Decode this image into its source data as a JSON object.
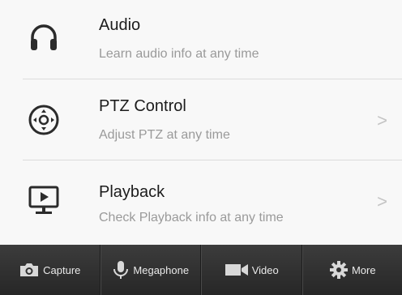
{
  "list": {
    "items": [
      {
        "icon": "headphones-icon",
        "title": "Audio",
        "subtitle": "Learn audio info at any time",
        "chevron": false
      },
      {
        "icon": "ptz-joystick-icon",
        "title": "PTZ Control",
        "subtitle": "Adjust PTZ at any time",
        "chevron": true
      },
      {
        "icon": "playback-monitor-icon",
        "title": "Playback",
        "subtitle": "Check Playback info at any time",
        "chevron": true
      }
    ],
    "chevron_glyph": ">"
  },
  "tabbar": {
    "tabs": [
      {
        "icon": "camera-icon",
        "label": "Capture"
      },
      {
        "icon": "microphone-icon",
        "label": "Megaphone"
      },
      {
        "icon": "video-camera-icon",
        "label": "Video"
      },
      {
        "icon": "gear-icon",
        "label": "More"
      }
    ]
  },
  "colors": {
    "background": "#f8f8f8",
    "tabbar": "#303030",
    "icon": "#2b2b2b",
    "subtitle": "#9a9a9a"
  }
}
